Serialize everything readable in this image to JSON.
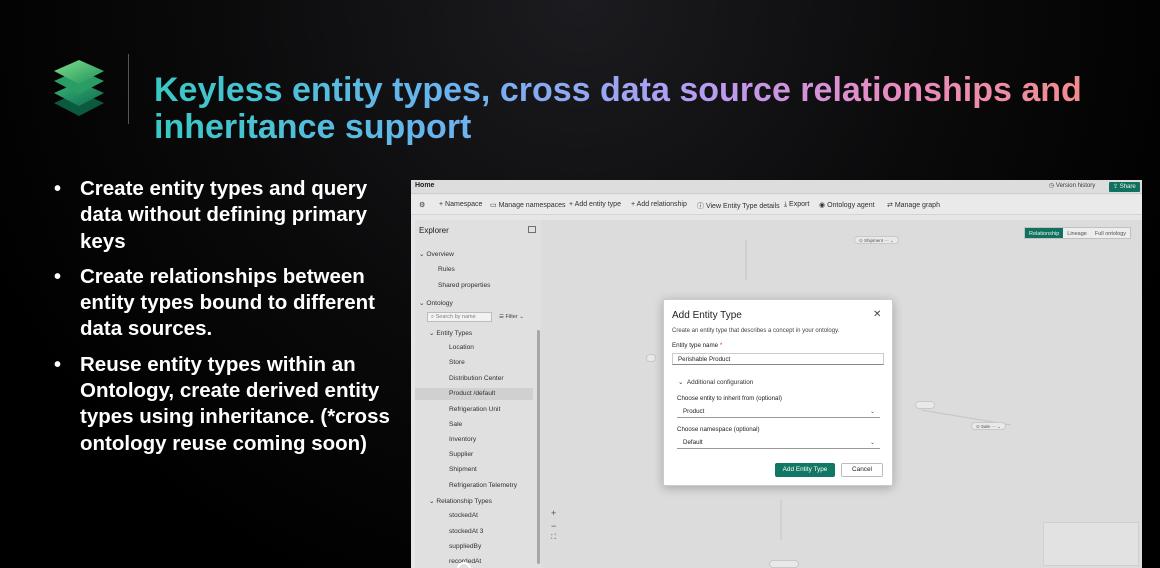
{
  "slide": {
    "title": "Keyless entity types, cross data source relationships and inheritance support",
    "bullets": [
      "Create entity types and query data without defining primary keys",
      "Create relationships between entity types bound to different data sources.",
      "Reuse entity types within an Ontology, create derived entity types using inheritance. (*cross ontology reuse coming soon)"
    ],
    "bullet_glyph": "•",
    "logo_icon": "layered-stack-icon",
    "accent_colors": [
      "#38c9c3",
      "#6ab3f0",
      "#b49ef5",
      "#e88bc4",
      "#f38d7e"
    ]
  },
  "app": {
    "tab": "Home",
    "version_history": "Version history",
    "share": "Share",
    "toolbar": [
      "Namespace",
      "Manage namespaces",
      "Add entity type",
      "Add relationship",
      "View Entity Type details",
      "Export",
      "Ontology agent",
      "Manage graph"
    ],
    "explorer": {
      "title": "Explorer",
      "overview": "Overview",
      "rules": "Rules",
      "shared_properties": "Shared properties",
      "ontology": "Ontology",
      "search_placeholder": "Search by name",
      "filter": "Filter",
      "entity_types_header": "Entity Types",
      "entity_types": [
        "Location",
        "Store",
        "Distribution Center",
        "Product /default",
        "Refrigeration Unit",
        "Sale",
        "Inventory",
        "Supplier",
        "Shipment",
        "Refrigeration Telemetry"
      ],
      "relationship_types_header": "Relationship Types",
      "relationship_types": [
        "stockedAt",
        "stockedAt 3",
        "suppliedBy",
        "recordedAt"
      ]
    },
    "view_tabs": [
      "Relationship",
      "Lineage",
      "Full ontology"
    ],
    "graph_nodes": [
      "Shipment",
      "Sale"
    ],
    "zoom_controls": [
      "+",
      "−",
      "⛶"
    ],
    "modal": {
      "title": "Add Entity Type",
      "description": "Create an entity type that describes a concept in your ontology.",
      "name_label": "Entity type name",
      "required_mark": "*",
      "name_value": "Perishable Product",
      "additional_config": "Additional configuration",
      "inherit_label": "Choose entity to inherit from (optional)",
      "inherit_value": "Product",
      "namespace_label": "Choose namespace (optional)",
      "namespace_value": "Default",
      "primary_button": "Add Entity Type",
      "cancel_button": "Cancel",
      "close_glyph": "✕"
    }
  }
}
